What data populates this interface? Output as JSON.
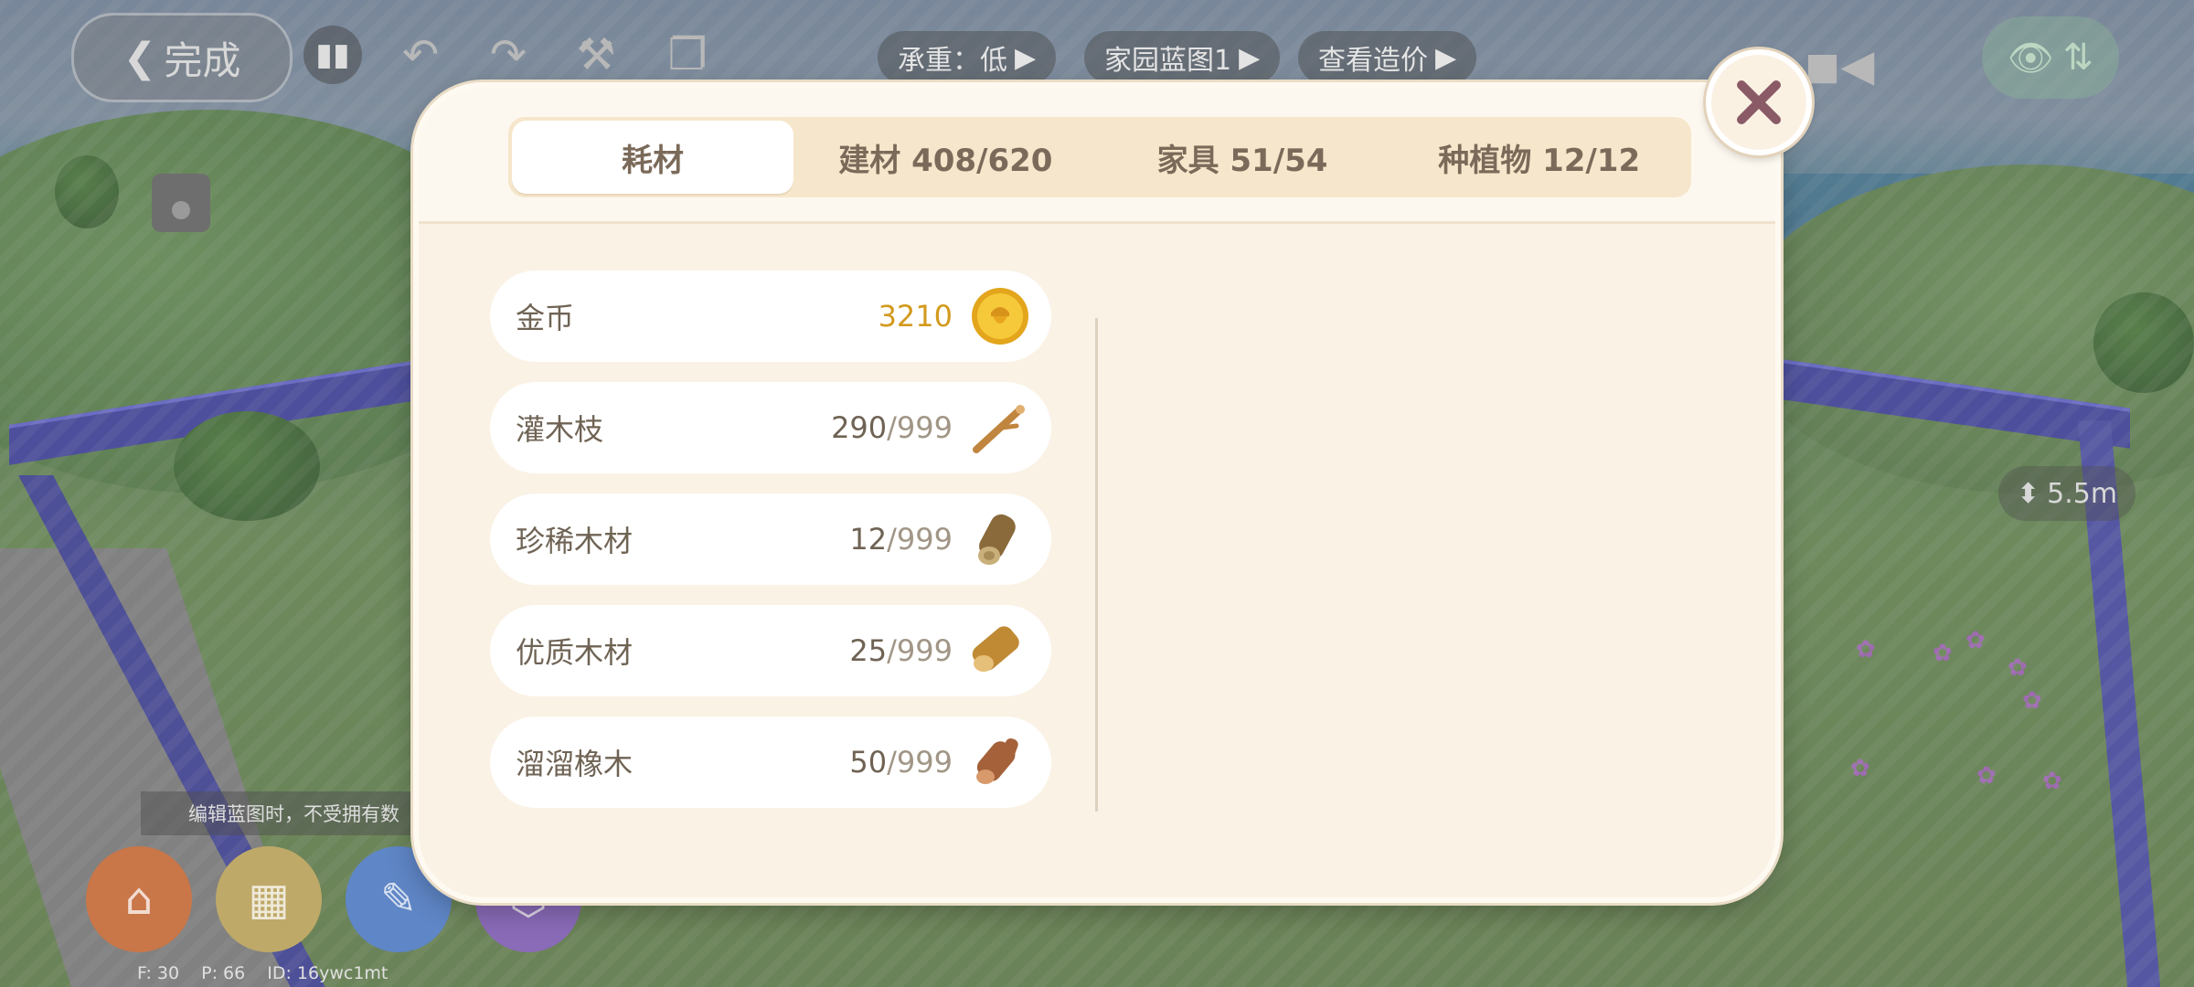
{
  "hud": {
    "done_label": "完成",
    "load_info": "承重：低",
    "blueprint_name": "家园蓝图1",
    "view_cost": "查看造价",
    "height_value": "5.5m",
    "notice_text": "编辑蓝图时，不受拥有数",
    "stats": {
      "f": "F: 30",
      "p": "P: 66",
      "id": "ID: 16ywc1mt"
    }
  },
  "tabs": [
    {
      "label": "耗材",
      "active": true
    },
    {
      "label": "建材 408/620",
      "active": false
    },
    {
      "label": "家具 51/54",
      "active": false
    },
    {
      "label": "种植物 12/12",
      "active": false
    }
  ],
  "items": [
    {
      "name": "金币",
      "count": "3210",
      "max": "",
      "icon": "gold-coin-icon"
    },
    {
      "name": "灌木枝",
      "count": "290",
      "max": "/999",
      "icon": "twig-icon"
    },
    {
      "name": "珍稀木材",
      "count": "12",
      "max": "/999",
      "icon": "rare-log-icon"
    },
    {
      "name": "优质木材",
      "count": "25",
      "max": "/999",
      "icon": "quality-log-icon"
    },
    {
      "name": "溜溜橡木",
      "count": "50",
      "max": "/999",
      "icon": "oak-log-icon"
    }
  ],
  "colors": {
    "panel": "#faf2e5",
    "tab_bar": "#f6e6cb",
    "gold_text": "#d39a1d",
    "text": "#6f6354",
    "close_x": "#8a5a66"
  }
}
